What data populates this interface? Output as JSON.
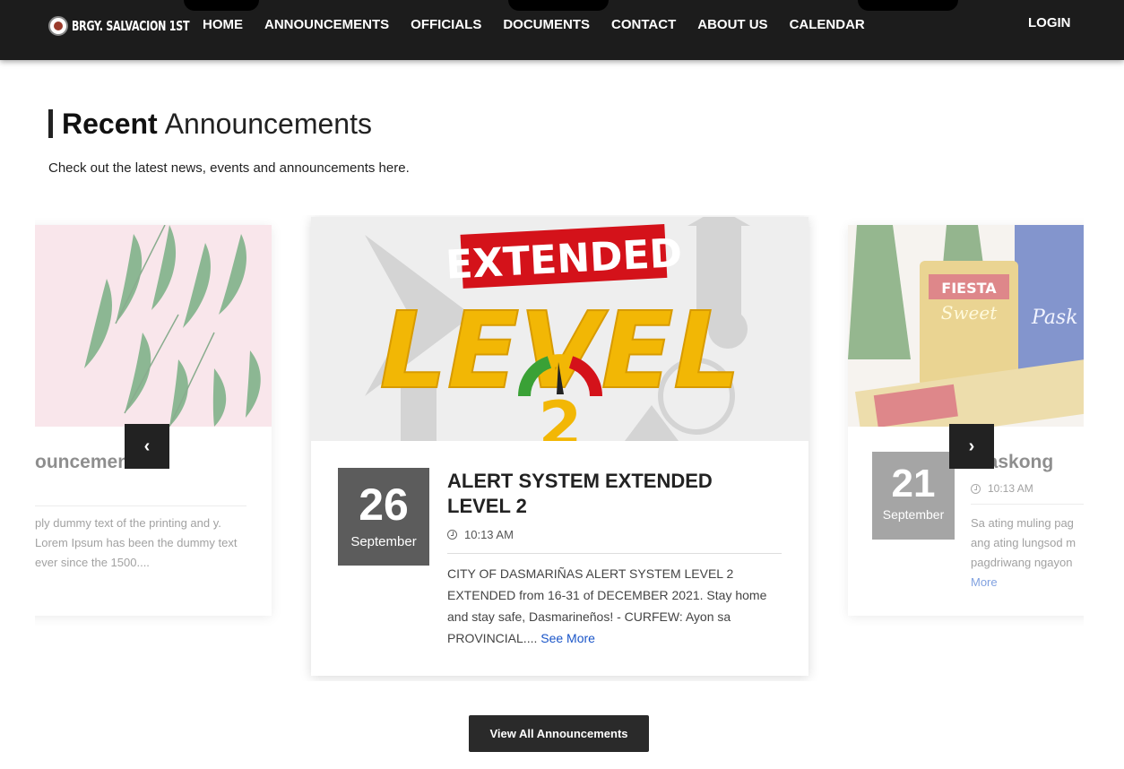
{
  "nav": {
    "brand": "BRGY. SALVACION 1ST",
    "items": [
      "HOME",
      "ANNOUNCEMENTS",
      "OFFICIALS",
      "DOCUMENTS",
      "CONTACT",
      "ABOUT US",
      "CALENDAR"
    ],
    "login": "LOGIN"
  },
  "section": {
    "title_bold": "Recent",
    "title_light": "Announcements",
    "subtitle": "Check out the latest news, events and announcements here."
  },
  "cards": {
    "left": {
      "title": "ouncement",
      "excerpt": "ply dummy text of the printing and y. Lorem Ipsum has been the dummy text ever since the 1500...."
    },
    "center": {
      "image_text_top": "EXTENDED",
      "image_text_main": "LEVEL",
      "image_text_num": "2",
      "day": "26",
      "month": "September",
      "title": "ALERT SYSTEM EXTENDED LEVEL 2",
      "time": "10:13 AM",
      "excerpt": "CITY OF DASMARIÑAS ALERT SYSTEM LEVEL 2 EXTENDED from 16-31 of DECEMBER 2021. Stay home and stay safe, Dasmarineños! - CURFEW: Ayon sa PROVINCIAL....",
      "see_more": "See More"
    },
    "right": {
      "image_text_1": "FIESTA",
      "image_text_2": "Sweet",
      "image_text_3": "Pask",
      "day": "21",
      "month": "September",
      "title": "maskong",
      "time": "10:13 AM",
      "excerpt": "Sa ating muling pag ang ating lungsod m pagdriwang ngayon",
      "see_more": "More"
    }
  },
  "controls": {
    "prev": "‹",
    "next": "›",
    "view_all": "View All Announcements"
  },
  "colors": {
    "nav_bg": "#1c1c1c",
    "date_box": "#5c5c5c",
    "link": "#1a55c8",
    "level_yellow": "#f2b705",
    "extended_red": "#d4121a"
  }
}
